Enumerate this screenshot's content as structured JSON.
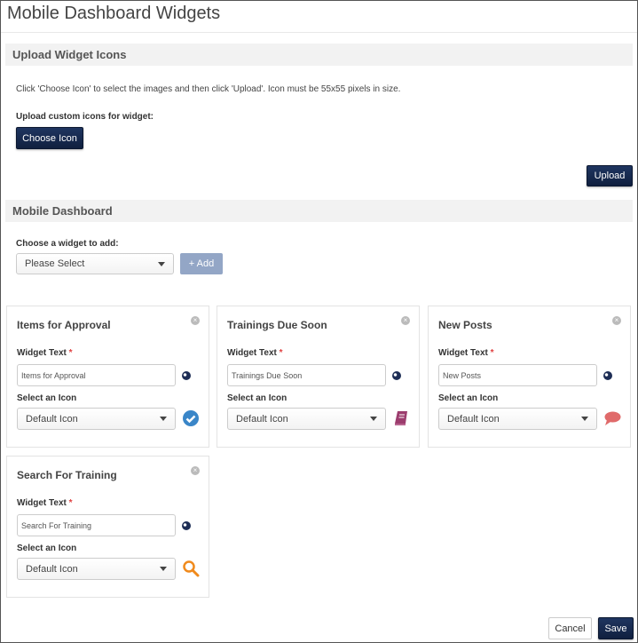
{
  "page_title": "Mobile Dashboard Widgets",
  "upload_section": {
    "heading": "Upload Widget Icons",
    "instructions": "Click 'Choose Icon' to select the images and then click 'Upload'. Icon must be 55x55 pixels in size.",
    "custom_label": "Upload custom icons for widget:",
    "choose_button": "Choose Icon",
    "upload_button": "Upload"
  },
  "dashboard_section": {
    "heading": "Mobile Dashboard",
    "choose_label": "Choose a widget to add:",
    "select_value": "Please Select",
    "add_button": "+ Add"
  },
  "widgets": [
    {
      "title": "Items for Approval",
      "text_label": "Widget Text",
      "required": "*",
      "text_value": "Items for Approval",
      "icon_label": "Select an Icon",
      "icon_value": "Default Icon",
      "icon": "check-circle-icon",
      "icon_color": "#3a86c8"
    },
    {
      "title": "Trainings Due Soon",
      "text_label": "Widget Text",
      "required": "*",
      "text_value": "Trainings Due Soon",
      "icon_label": "Select an Icon",
      "icon_value": "Default Icon",
      "icon": "book-icon",
      "icon_color": "#9c3d6e"
    },
    {
      "title": "New Posts",
      "text_label": "Widget Text",
      "required": "*",
      "text_value": "New Posts",
      "icon_label": "Select an Icon",
      "icon_value": "Default Icon",
      "icon": "speech-bubble-icon",
      "icon_color": "#e06a6a"
    },
    {
      "title": "Search For Training",
      "text_label": "Widget Text",
      "required": "*",
      "text_value": "Search For Training",
      "icon_label": "Select an Icon",
      "icon_value": "Default Icon",
      "icon": "search-icon",
      "icon_color": "#f08a1c"
    }
  ],
  "footer": {
    "cancel": "Cancel",
    "save": "Save"
  }
}
